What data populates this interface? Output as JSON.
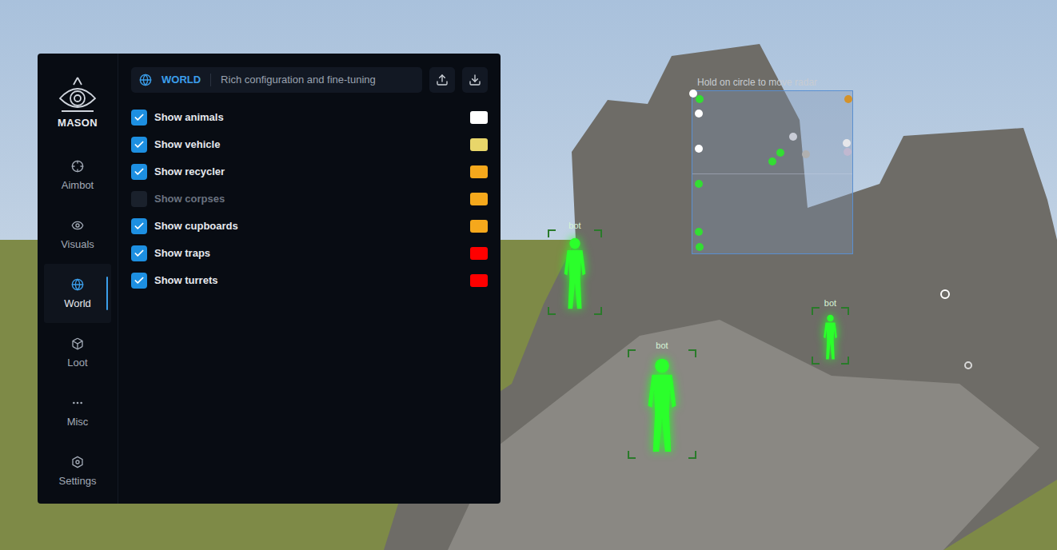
{
  "menu": {
    "brand": "MASON",
    "nav": [
      {
        "label": "Aimbot",
        "selected": false
      },
      {
        "label": "Visuals",
        "selected": false
      },
      {
        "label": "World",
        "selected": true
      },
      {
        "label": "Loot",
        "selected": false
      },
      {
        "label": "Misc",
        "selected": false
      },
      {
        "label": "Settings",
        "selected": false
      }
    ],
    "header": {
      "section": "WORLD",
      "subtitle": "Rich configuration and fine-tuning"
    },
    "options": [
      {
        "label": "Show animals",
        "checked": true,
        "color": "#ffffff"
      },
      {
        "label": "Show vehicle",
        "checked": true,
        "color": "#e8d66a"
      },
      {
        "label": "Show recycler",
        "checked": true,
        "color": "#f5a81c"
      },
      {
        "label": "Show corpses",
        "checked": false,
        "color": "#f5a81c"
      },
      {
        "label": "Show cupboards",
        "checked": true,
        "color": "#f5a81c"
      },
      {
        "label": "Show traps",
        "checked": true,
        "color": "#ff0000"
      },
      {
        "label": "Show turrets",
        "checked": true,
        "color": "#ff0000"
      }
    ]
  },
  "radar": {
    "hint": "Hold on circle to move radar",
    "dots": [
      {
        "color": "#ffffff"
      },
      {
        "color": "#33dd33"
      },
      {
        "color": "#ffffff"
      },
      {
        "color": "#d4922a"
      },
      {
        "color": "#c9ccd6"
      },
      {
        "color": "#e6e6ea"
      },
      {
        "color": "#c0b8d0"
      },
      {
        "color": "#b0b0b0"
      },
      {
        "color": "#33dd33"
      },
      {
        "color": "#33dd33"
      },
      {
        "color": "#ffffff"
      },
      {
        "color": "#33dd33"
      },
      {
        "color": "#33dd33"
      },
      {
        "color": "#33dd33"
      }
    ]
  },
  "esp": [
    {
      "label": "bot"
    },
    {
      "label": "bot"
    },
    {
      "label": "bot"
    }
  ]
}
